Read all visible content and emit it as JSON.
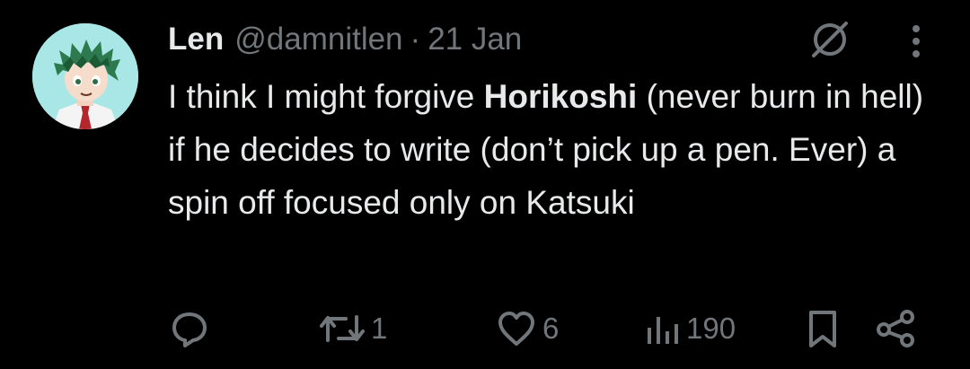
{
  "tweet": {
    "author_name": "Len",
    "author_handle": "@damnitlen",
    "separator": "·",
    "date": "21 Jan",
    "text_part1": "I think I might forgive ",
    "text_bold": "Horikoshi",
    "text_part2": " (never burn in hell) if he decides to write (don’t pick up a pen. Ever) a spin off focused only on Katsuki"
  },
  "actions": {
    "replies": "",
    "retweets": "1",
    "likes": "6",
    "views": "190"
  },
  "icons": {
    "avatar": "avatar-anime-boy-green-hair",
    "grok": "grok-icon",
    "more": "more-dots-icon",
    "reply": "reply-icon",
    "retweet": "retweet-icon",
    "like": "heart-icon",
    "views": "views-bar-chart-icon",
    "bookmark": "bookmark-icon",
    "share": "share-icon"
  },
  "colors": {
    "background": "#000000",
    "primary_text": "#e7e9ea",
    "secondary_text": "#71767b",
    "avatar_bg": "#a9e7e6"
  }
}
